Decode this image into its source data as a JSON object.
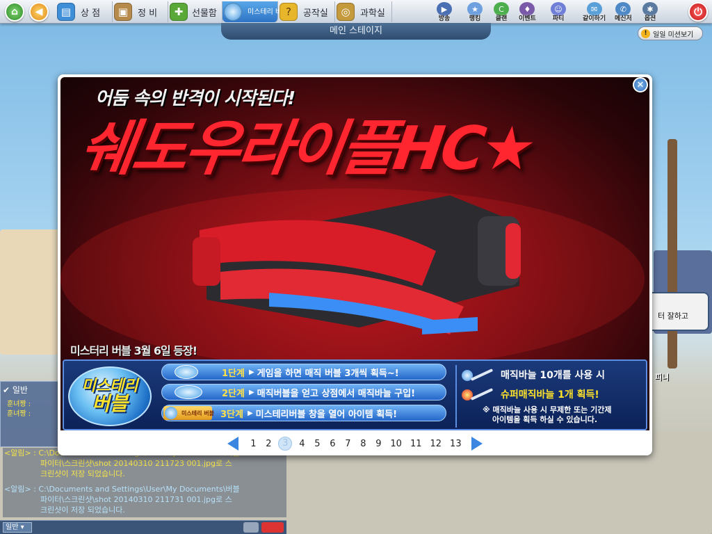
{
  "topbar": {
    "nav": [
      {
        "label": "상 점",
        "icon": "shop-icon",
        "color": "#3f8fd8"
      },
      {
        "label": "정 비",
        "icon": "backpack-icon",
        "color": "#b58a4a"
      },
      {
        "label": "선물함",
        "icon": "gift-icon",
        "color": "#5aa838"
      },
      {
        "label": "미스테리 버블",
        "icon": "bubble-icon",
        "color": "#5ab5f0"
      },
      {
        "label": "공작실",
        "icon": "lightbulb-icon",
        "color": "#e7b62a"
      },
      {
        "label": "과학실",
        "icon": "lab-icon",
        "color": "#c49a3c"
      }
    ],
    "right": [
      {
        "label": "방송",
        "icon": "broadcast-icon",
        "color": "#4a6fb3"
      },
      {
        "label": "랭킹",
        "icon": "rank-icon",
        "color": "#6ea0e0"
      },
      {
        "label": "클랜",
        "icon": "clan-icon",
        "color": "#4cae4c"
      },
      {
        "label": "이벤트",
        "icon": "event-icon",
        "color": "#7a5aa8"
      },
      {
        "label": "파티",
        "icon": "party-icon",
        "color": "#6f7fd8"
      },
      {
        "label": "같이하기",
        "icon": "together-icon",
        "color": "#5aa0d8"
      },
      {
        "label": "메신저",
        "icon": "messenger-icon",
        "color": "#4d89c7"
      },
      {
        "label": "옵션",
        "icon": "option-icon",
        "color": "#5b7aa0"
      }
    ]
  },
  "stage": {
    "title": "메인 스테이지"
  },
  "mission": {
    "label": "일일 미션보기"
  },
  "banner": {
    "tagline": "어둠 속의 반격이 시작된다!",
    "title": "쉐도우라이플HC★",
    "date": "미스터리 버블 3월 6일 등장!"
  },
  "info": {
    "bubble_line1": "미스테리",
    "bubble_line2": "버블",
    "steps": [
      {
        "num": "1단계",
        "text": "게임을 하면 매직 버블 3개씩 획득~!"
      },
      {
        "num": "2단계",
        "text": "매직버블을 얻고 상점에서 매직바늘 구입!"
      },
      {
        "num": "3단계",
        "text": "미스테리버블 창을 열어 아이템 획득!",
        "box_label": "미스테리 버블"
      }
    ],
    "right_line1": "매직바늘 10개를 사용 시",
    "right_line2": "슈퍼매직바늘 1개 획득!",
    "note": "※ 매직바늘 사용 시 무제한 또는 기간제\n아이템을 획득 하실 수 있습니다."
  },
  "pager": {
    "pages": [
      "1",
      "2",
      "3",
      "4",
      "5",
      "6",
      "7",
      "8",
      "9",
      "10",
      "11",
      "12",
      "13"
    ],
    "current": "3"
  },
  "chat": {
    "tab": "일반",
    "lines": [
      "훈녀짱 : ",
      "훈녀짱 : "
    ],
    "logs": [
      "<알림> : C:\\Documents and Settings\\User\\My Documents\\버블",
      "파이터\\스크린샷\\shot 20140310 211723 001.jpg로 스",
      "크린샷이 저장 되었습니다.",
      "<알림> : C:\\Documents and Settings\\User\\My Documents\\버블",
      "파이터\\스크린샷\\shot 20140310 211731 001.jpg로 스",
      "크린샷이 저장 되었습니다."
    ],
    "mode": "일반"
  },
  "npc": {
    "tip": "터 잘하고",
    "name": "피니"
  }
}
